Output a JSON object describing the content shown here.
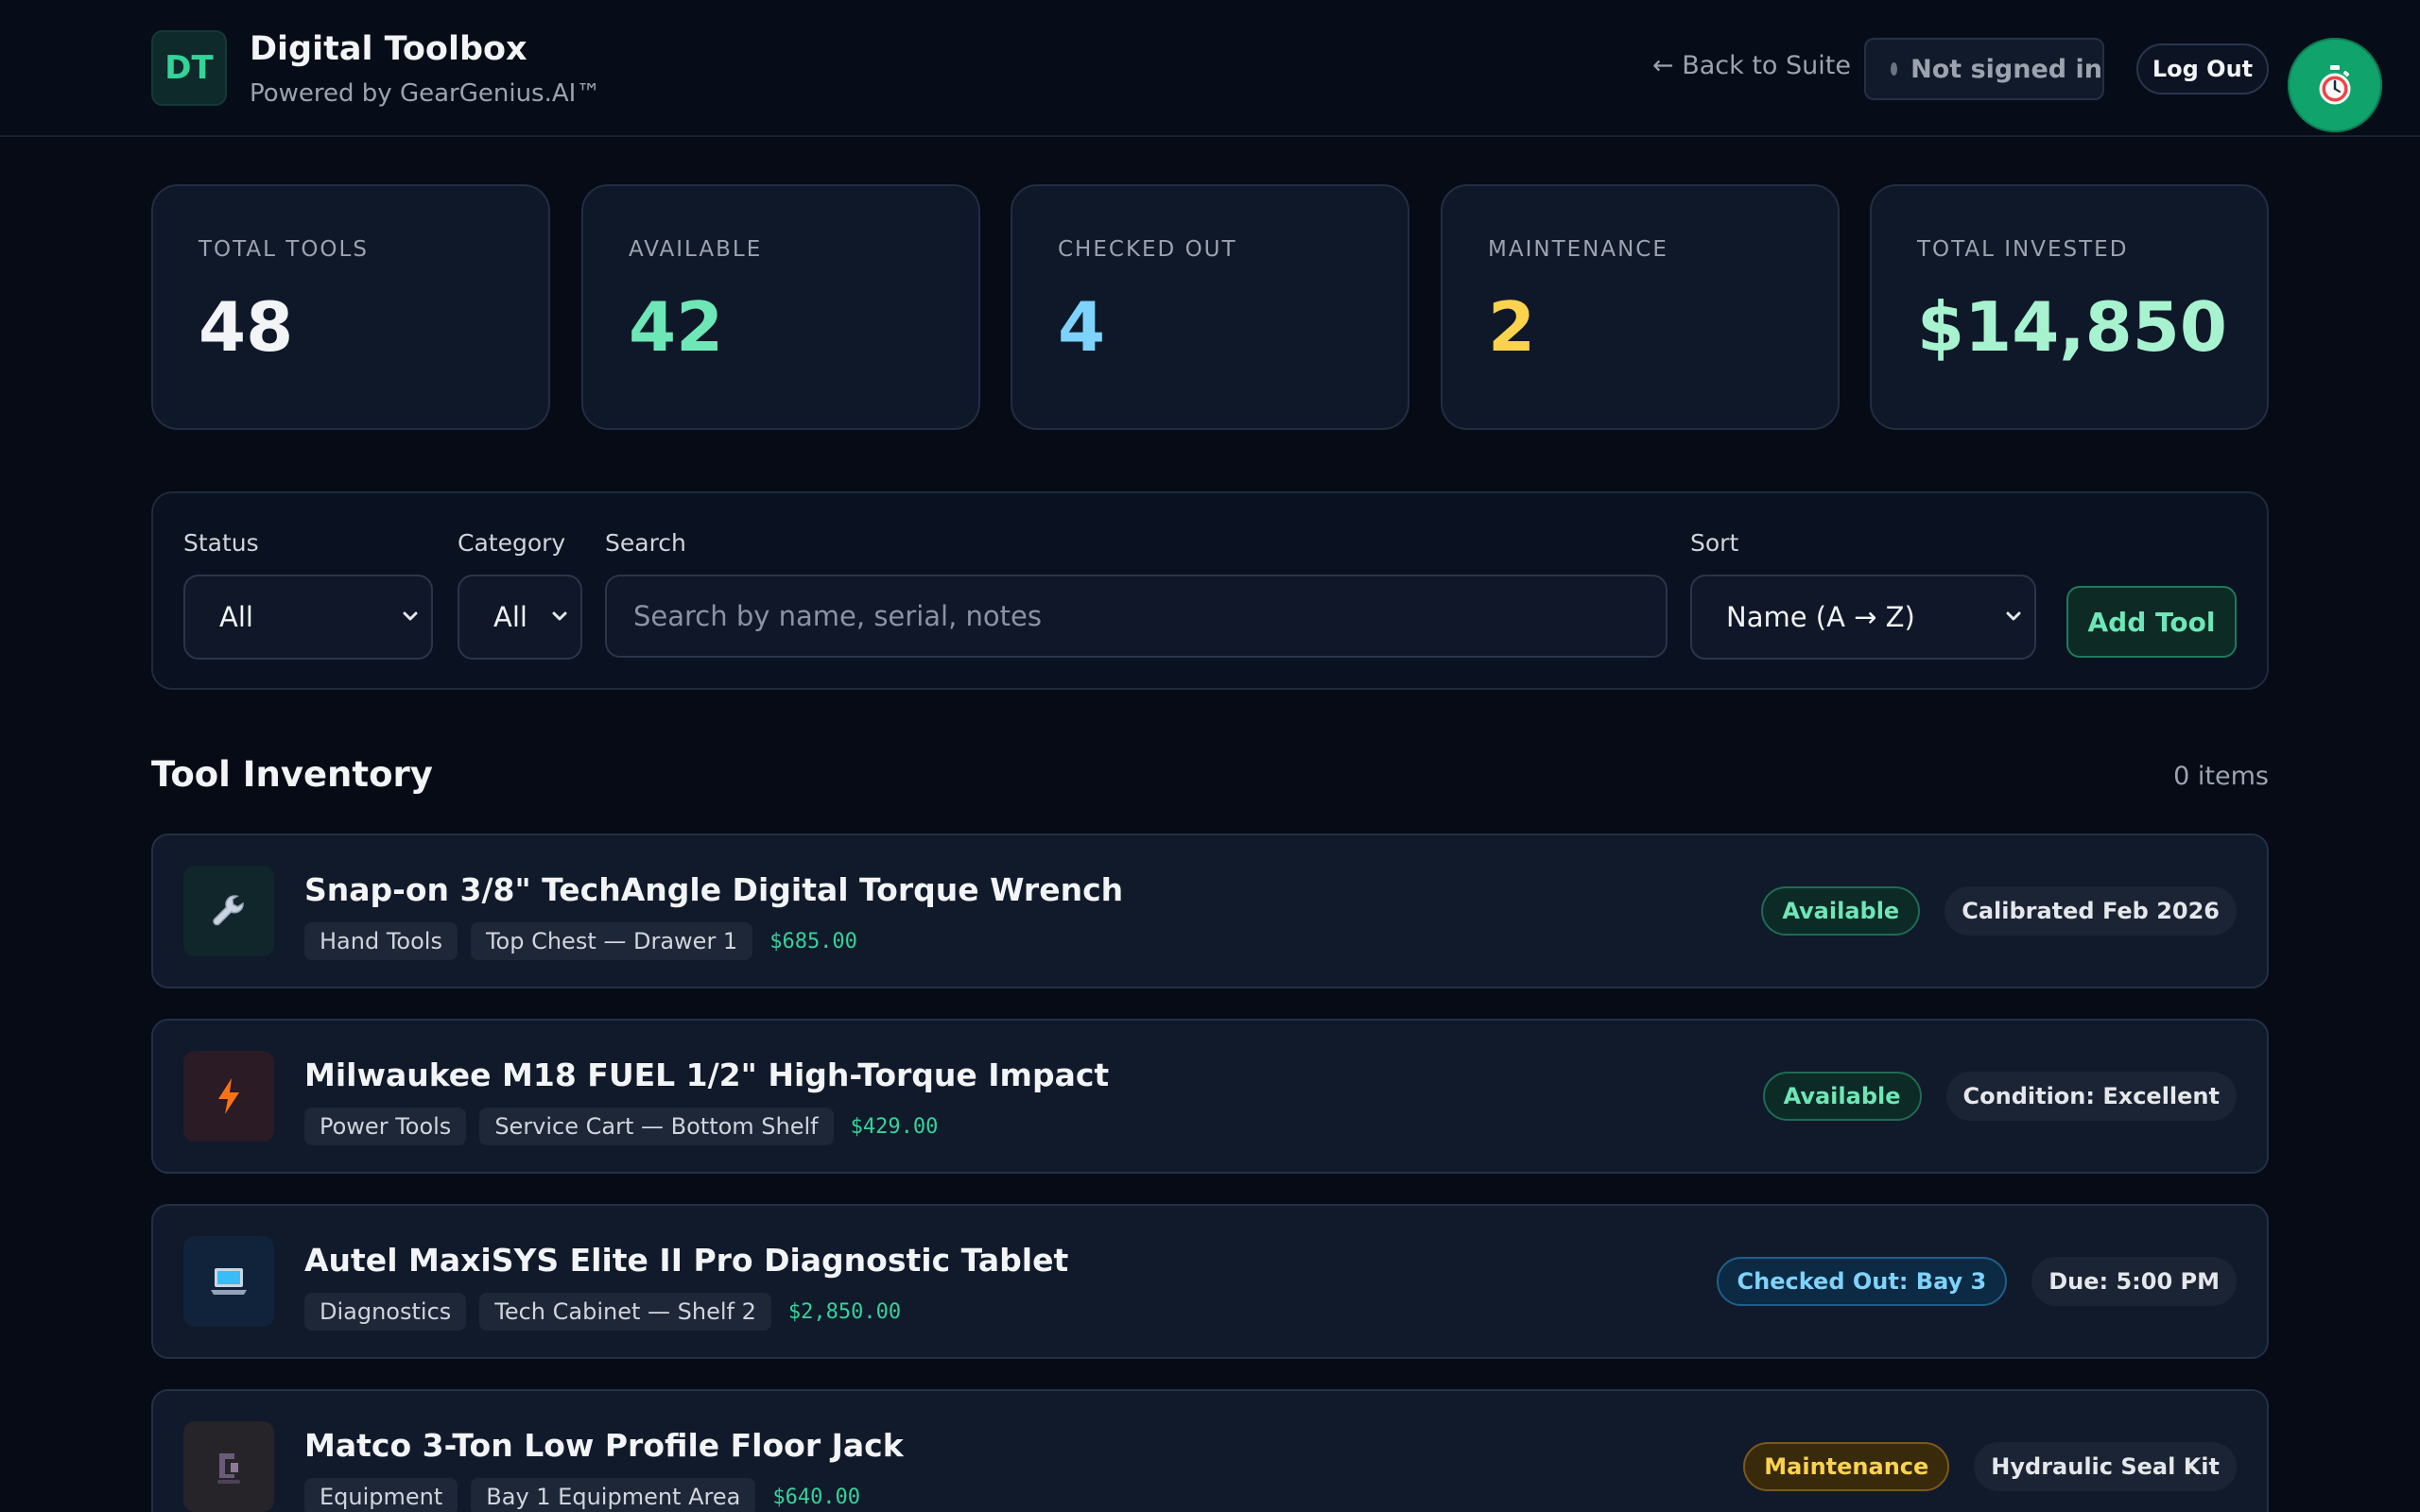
{
  "header": {
    "logo_initials": "DT",
    "title": "Digital Toolbox",
    "subtitle": "Powered by GearGenius.AI™",
    "back_link": "← Back to Suite",
    "signin_status": "Not signed in",
    "logout_label": "Log Out",
    "timer_icon": "stopwatch-icon"
  },
  "stats": [
    {
      "label": "TOTAL TOOLS",
      "value": "48",
      "color": "#f3f4f6"
    },
    {
      "label": "AVAILABLE",
      "value": "42",
      "color": "#6ee7b7"
    },
    {
      "label": "CHECKED OUT",
      "value": "4",
      "color": "#7dd3fc"
    },
    {
      "label": "MAINTENANCE",
      "value": "2",
      "color": "#fcd34d"
    },
    {
      "label": "TOTAL INVESTED",
      "value": "$14,850",
      "color": "#a7f3d0"
    }
  ],
  "filters": {
    "status_label": "Status",
    "status_value": "All",
    "category_label": "Category",
    "category_value": "All",
    "search_label": "Search",
    "search_placeholder": "Search by name, serial, notes",
    "search_value": "",
    "sort_label": "Sort",
    "sort_value": "Name (A → Z)",
    "add_label": "Add Tool"
  },
  "inventory": {
    "title": "Tool Inventory",
    "count": "0 items",
    "tools": [
      {
        "name": "Snap-on 3/8\" TechAngle Digital Torque Wrench",
        "category": "Hand Tools",
        "location": "Top Chest — Drawer 1",
        "price": "$685.00",
        "status": "Available",
        "info": "Calibrated Feb 2026",
        "icon": "wrench-icon"
      },
      {
        "name": "Milwaukee M18 FUEL 1/2\" High-Torque Impact",
        "category": "Power Tools",
        "location": "Service Cart — Bottom Shelf",
        "price": "$429.00",
        "status": "Available",
        "info": "Condition: Excellent",
        "icon": "lightning-icon"
      },
      {
        "name": "Autel MaxiSYS Elite II Pro Diagnostic Tablet",
        "category": "Diagnostics",
        "location": "Tech Cabinet — Shelf 2",
        "price": "$2,850.00",
        "status": "Checked Out: Bay 3",
        "info": "Due: 5:00 PM",
        "icon": "laptop-icon"
      },
      {
        "name": "Matco 3-Ton Low Profile Floor Jack",
        "category": "Equipment",
        "location": "Bay 1 Equipment Area",
        "price": "$640.00",
        "status": "Maintenance",
        "info": "Hydraulic Seal Kit",
        "icon": "floor-jack-icon"
      }
    ]
  }
}
